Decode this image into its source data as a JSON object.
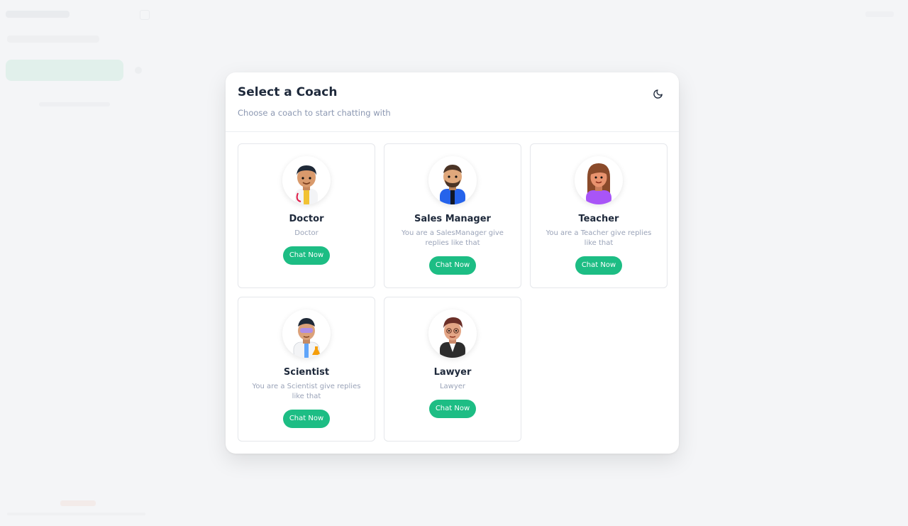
{
  "modal": {
    "title": "Select a Coach",
    "subtitle": "Choose a coach to start chatting with",
    "theme_toggle_icon": "moon-icon"
  },
  "coaches": [
    {
      "name": "Doctor",
      "description": "Doctor",
      "button_label": "Chat Now",
      "avatar_icon": "doctor-avatar-icon"
    },
    {
      "name": "Sales Manager",
      "description": "You are a SalesManager give replies like that",
      "button_label": "Chat Now",
      "avatar_icon": "sales-manager-avatar-icon"
    },
    {
      "name": "Teacher",
      "description": "You are a Teacher give replies like that",
      "button_label": "Chat Now",
      "avatar_icon": "teacher-avatar-icon"
    },
    {
      "name": "Scientist",
      "description": "You are a Scientist give replies like that",
      "button_label": "Chat Now",
      "avatar_icon": "scientist-avatar-icon"
    },
    {
      "name": "Lawyer",
      "description": "Lawyer",
      "button_label": "Chat Now",
      "avatar_icon": "lawyer-avatar-icon"
    }
  ],
  "colors": {
    "accent": "#1dbd84",
    "title": "#1e293b",
    "muted": "#8b97b1",
    "overlay_background": "#f4f5f7"
  }
}
